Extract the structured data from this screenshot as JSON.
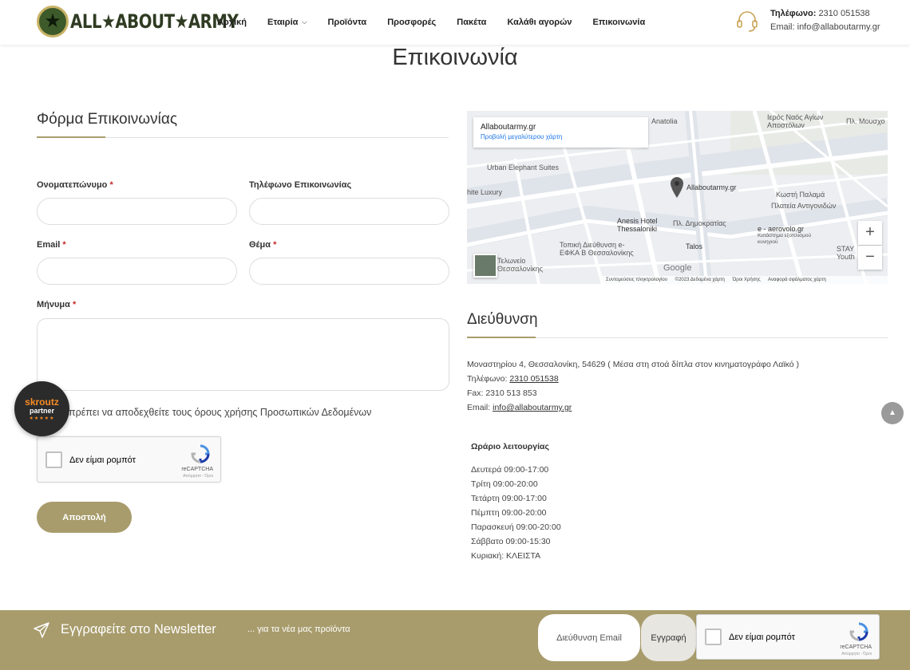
{
  "header": {
    "logo_text": "ALL★ABOUT★ARMY",
    "nav": [
      {
        "label": "Αρχική",
        "has_dropdown": false
      },
      {
        "label": "Εταιρία",
        "has_dropdown": true
      },
      {
        "label": "Προϊόντα",
        "has_dropdown": false
      },
      {
        "label": "Προσφορές",
        "has_dropdown": false
      },
      {
        "label": "Πακέτα",
        "has_dropdown": false
      },
      {
        "label": "Καλάθι αγορών",
        "has_dropdown": false
      },
      {
        "label": "Επικοινωνία",
        "has_dropdown": false
      }
    ],
    "phone_label": "Τηλέφωνο:",
    "phone_value": "2310 051538",
    "email_label": "Email:",
    "email_value": "info@allaboutarmy.gr"
  },
  "page_title": "Επικοινωνία",
  "form": {
    "title": "Φόρμα Επικοινωνίας",
    "name_label": "Ονοματεπώνυμο",
    "phone_label": "Τηλέφωνο Επικοινωνίας",
    "email_label": "Email",
    "subject_label": "Θέμα",
    "message_label": "Μήνυμα",
    "required_mark": "*",
    "consent_text": "πρέπει να αποδεχθείτε τους όρους χρήσης Προσωπικών Δεδομένων",
    "submit_label": "Αποστολή"
  },
  "recaptcha": {
    "label": "Δεν είμαι ρομπότ",
    "brand": "reCAPTCHA",
    "terms": "Απόρρητο - Όροι"
  },
  "skroutz": {
    "name": "skroutz",
    "tag": "partner",
    "stars": "★★★★★"
  },
  "map": {
    "place_name": "Allaboutarmy.gr",
    "larger_map_link": "Προβολή μεγαλύτερου χάρτη",
    "labels": {
      "anatolia": "Anatolia",
      "church": "Ιερός Ναός Αγίων Αποστόλων",
      "square": "Πλ. Μουσχο",
      "urban": "Urban Elephant Suites",
      "luxury": "hite Luxury",
      "pin": "Allaboutarmy.gr",
      "kosti": "Κωστή Παλαμά",
      "antigonidon": "Πλατεία Αντιγονιδών",
      "anesis": "Anesis Hotel Thessaloniki",
      "dimokratias": "Πλ. Δημοκρατίας",
      "aerovolo": "e - aerovolo.gr",
      "aerovolo_sub": "Κατάστημα εξοπλισμού κυνηγιού",
      "efka": "Τοπική Διεύθυνση e-ΕΦΚΑ Β Θεσσαλονίκης",
      "talos": "Talos",
      "stay": "STAY Youth",
      "telonio": "Τελωνείο Θεσσαλονίκης",
      "google": "Google"
    },
    "footer": [
      "Συντομεύσεις πληκτρολογίου",
      "©2023 Δεδομένα χάρτη",
      "Όροι Χρήσης",
      "Αναφορά σφάλματος χάρτη"
    ],
    "zoom_in": "+",
    "zoom_out": "−"
  },
  "address": {
    "title": "Διεύθυνση",
    "line": "Μοναστηρίου 4, Θεσσαλονίκη, 54629 ( Μέσα στη στοά δίπλα στον κινηματογράφο Λαϊκό )",
    "phone_label": "Τηλέφωνο:",
    "phone": "2310 051538",
    "fax": "Fax: 2310 513 853",
    "email_label": "Email:",
    "email": "info@allaboutarmy.gr",
    "hours_title": "Ωράριο λειτουργίας",
    "hours": [
      "Δευτερά 09:00-17:00",
      "Τρίτη 09:00-20:00",
      "Τετάρτη 09:00-17:00",
      "Πέμπτη 09:00-20:00",
      "Παρασκευή 09:00-20:00",
      "Σάββατο 09:00-15:30",
      "Κυριακή: ΚΛΕΙΣΤΑ"
    ]
  },
  "newsletter": {
    "title": "Εγγραφείτε στο Newsletter",
    "subtitle": "... για τα νέα μας προϊόντα",
    "email_placeholder": "Διεύθυνση Email",
    "button_label": "Εγγραφή"
  },
  "colors": {
    "accent": "#a89c6c",
    "link_blue": "#1a73e8",
    "required": "#c62828",
    "skroutz_orange": "#f68b24"
  }
}
